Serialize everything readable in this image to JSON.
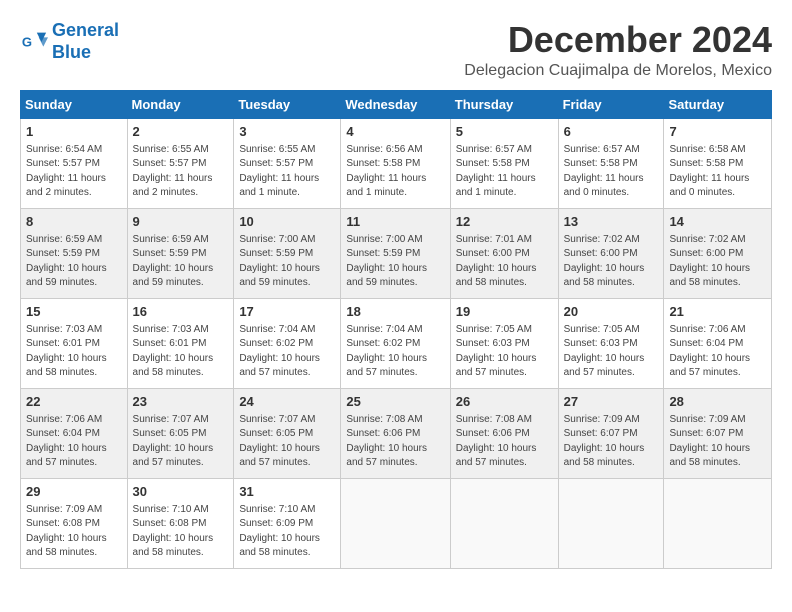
{
  "logo": {
    "line1": "General",
    "line2": "Blue"
  },
  "title": "December 2024",
  "location": "Delegacion Cuajimalpa de Morelos, Mexico",
  "weekdays": [
    "Sunday",
    "Monday",
    "Tuesday",
    "Wednesday",
    "Thursday",
    "Friday",
    "Saturday"
  ],
  "weeks": [
    [
      {
        "day": "1",
        "sunrise": "6:54 AM",
        "sunset": "5:57 PM",
        "daylight": "11 hours and 2 minutes."
      },
      {
        "day": "2",
        "sunrise": "6:55 AM",
        "sunset": "5:57 PM",
        "daylight": "11 hours and 2 minutes."
      },
      {
        "day": "3",
        "sunrise": "6:55 AM",
        "sunset": "5:57 PM",
        "daylight": "11 hours and 1 minute."
      },
      {
        "day": "4",
        "sunrise": "6:56 AM",
        "sunset": "5:58 PM",
        "daylight": "11 hours and 1 minute."
      },
      {
        "day": "5",
        "sunrise": "6:57 AM",
        "sunset": "5:58 PM",
        "daylight": "11 hours and 1 minute."
      },
      {
        "day": "6",
        "sunrise": "6:57 AM",
        "sunset": "5:58 PM",
        "daylight": "11 hours and 0 minutes."
      },
      {
        "day": "7",
        "sunrise": "6:58 AM",
        "sunset": "5:58 PM",
        "daylight": "11 hours and 0 minutes."
      }
    ],
    [
      {
        "day": "8",
        "sunrise": "6:59 AM",
        "sunset": "5:59 PM",
        "daylight": "10 hours and 59 minutes."
      },
      {
        "day": "9",
        "sunrise": "6:59 AM",
        "sunset": "5:59 PM",
        "daylight": "10 hours and 59 minutes."
      },
      {
        "day": "10",
        "sunrise": "7:00 AM",
        "sunset": "5:59 PM",
        "daylight": "10 hours and 59 minutes."
      },
      {
        "day": "11",
        "sunrise": "7:00 AM",
        "sunset": "5:59 PM",
        "daylight": "10 hours and 59 minutes."
      },
      {
        "day": "12",
        "sunrise": "7:01 AM",
        "sunset": "6:00 PM",
        "daylight": "10 hours and 58 minutes."
      },
      {
        "day": "13",
        "sunrise": "7:02 AM",
        "sunset": "6:00 PM",
        "daylight": "10 hours and 58 minutes."
      },
      {
        "day": "14",
        "sunrise": "7:02 AM",
        "sunset": "6:00 PM",
        "daylight": "10 hours and 58 minutes."
      }
    ],
    [
      {
        "day": "15",
        "sunrise": "7:03 AM",
        "sunset": "6:01 PM",
        "daylight": "10 hours and 58 minutes."
      },
      {
        "day": "16",
        "sunrise": "7:03 AM",
        "sunset": "6:01 PM",
        "daylight": "10 hours and 58 minutes."
      },
      {
        "day": "17",
        "sunrise": "7:04 AM",
        "sunset": "6:02 PM",
        "daylight": "10 hours and 57 minutes."
      },
      {
        "day": "18",
        "sunrise": "7:04 AM",
        "sunset": "6:02 PM",
        "daylight": "10 hours and 57 minutes."
      },
      {
        "day": "19",
        "sunrise": "7:05 AM",
        "sunset": "6:03 PM",
        "daylight": "10 hours and 57 minutes."
      },
      {
        "day": "20",
        "sunrise": "7:05 AM",
        "sunset": "6:03 PM",
        "daylight": "10 hours and 57 minutes."
      },
      {
        "day": "21",
        "sunrise": "7:06 AM",
        "sunset": "6:04 PM",
        "daylight": "10 hours and 57 minutes."
      }
    ],
    [
      {
        "day": "22",
        "sunrise": "7:06 AM",
        "sunset": "6:04 PM",
        "daylight": "10 hours and 57 minutes."
      },
      {
        "day": "23",
        "sunrise": "7:07 AM",
        "sunset": "6:05 PM",
        "daylight": "10 hours and 57 minutes."
      },
      {
        "day": "24",
        "sunrise": "7:07 AM",
        "sunset": "6:05 PM",
        "daylight": "10 hours and 57 minutes."
      },
      {
        "day": "25",
        "sunrise": "7:08 AM",
        "sunset": "6:06 PM",
        "daylight": "10 hours and 57 minutes."
      },
      {
        "day": "26",
        "sunrise": "7:08 AM",
        "sunset": "6:06 PM",
        "daylight": "10 hours and 57 minutes."
      },
      {
        "day": "27",
        "sunrise": "7:09 AM",
        "sunset": "6:07 PM",
        "daylight": "10 hours and 58 minutes."
      },
      {
        "day": "28",
        "sunrise": "7:09 AM",
        "sunset": "6:07 PM",
        "daylight": "10 hours and 58 minutes."
      }
    ],
    [
      {
        "day": "29",
        "sunrise": "7:09 AM",
        "sunset": "6:08 PM",
        "daylight": "10 hours and 58 minutes."
      },
      {
        "day": "30",
        "sunrise": "7:10 AM",
        "sunset": "6:08 PM",
        "daylight": "10 hours and 58 minutes."
      },
      {
        "day": "31",
        "sunrise": "7:10 AM",
        "sunset": "6:09 PM",
        "daylight": "10 hours and 58 minutes."
      },
      null,
      null,
      null,
      null
    ]
  ]
}
